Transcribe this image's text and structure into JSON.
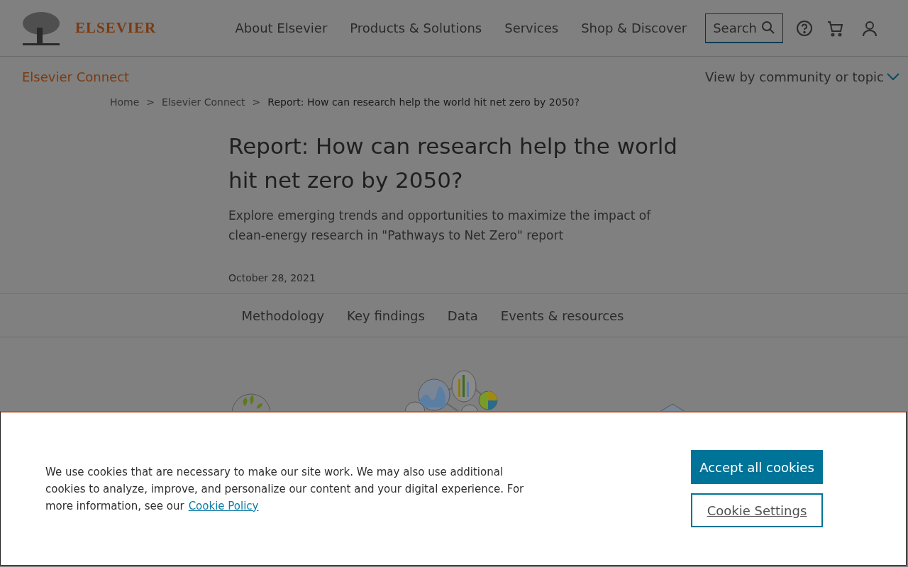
{
  "header": {
    "logo_text": "ELSEVIER",
    "nav": [
      "About Elsevier",
      "Products & Solutions",
      "Services",
      "Shop & Discover"
    ],
    "search": {
      "label": "Search"
    }
  },
  "subnav": {
    "title": "Elsevier Connect",
    "topic_menu": "View by community or topic"
  },
  "breadcrumb": [
    {
      "label": "Home",
      "current": false
    },
    {
      "label": "Elsevier Connect",
      "current": false
    },
    {
      "label": "Report: How can research help the world hit net zero by 2050?",
      "current": true
    }
  ],
  "breadcrumb_separator": ">",
  "article": {
    "title": "Report: How can research help the world hit net zero by 2050?",
    "subtitle": "Explore emerging trends and opportunities to maximize the impact of clean-energy research in \"Pathways to Net Zero\" report",
    "date": "October 28, 2021"
  },
  "section_tabs": [
    "Methodology",
    "Key findings",
    "Data",
    "Events & resources"
  ],
  "cookie_banner": {
    "text": "We use cookies that are necessary to make our site work. We may also use additional cookies to analyze, improve, and personalize our content and your digital experience. For more information, see our",
    "link": "Cookie Policy",
    "accept_button": "Accept all cookies",
    "settings_button": "Cookie Settings"
  }
}
